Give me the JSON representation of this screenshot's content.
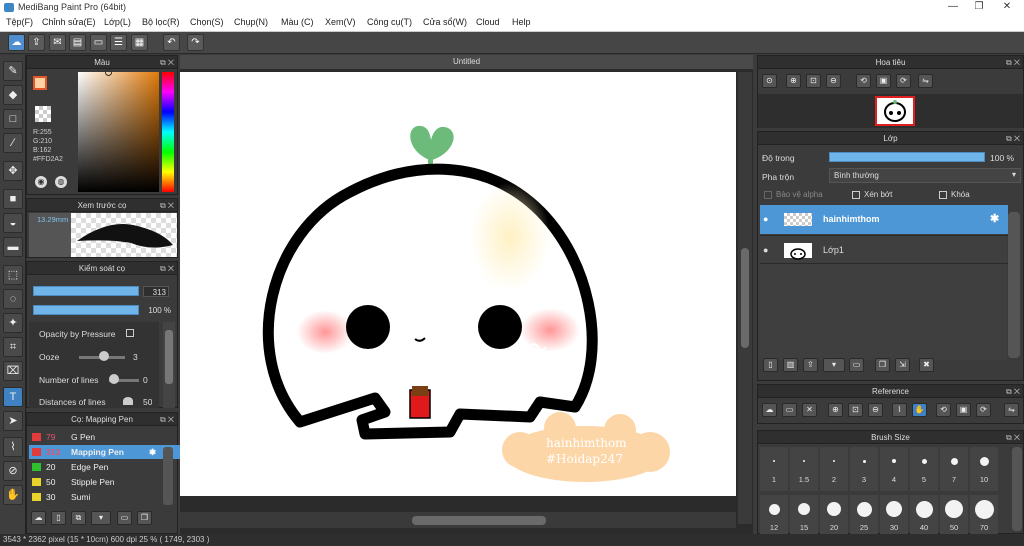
{
  "window": {
    "title": "MediBang Paint Pro (64bit)",
    "minimize": "—",
    "restore": "❐",
    "close": "✕"
  },
  "menu": [
    "Tệp(F)",
    "Chỉnh sửa(E)",
    "Lớp(L)",
    "Bộ lọc(R)",
    "Chọn(S)",
    "Chụp(N)",
    "Màu (C)",
    "Xem(V)",
    "Công cụ(T)",
    "Cửa sổ(W)",
    "Cloud",
    "Help"
  ],
  "canvas": {
    "tab_title": "Untitled",
    "watermark_line1": "hainhimthom",
    "watermark_line2": "#Hoidap247"
  },
  "color_panel": {
    "title": "Màu",
    "r": "R:255",
    "g": "G:210",
    "b": "B:162",
    "hex": "#FFD2A2",
    "accent": "#FFD2A2"
  },
  "brush_preview": {
    "title": "Xem trước cọ",
    "size": "13.29mm"
  },
  "brush_control": {
    "title": "Kiểm soát cọ",
    "size_value": "313",
    "opacity_value": "100 %",
    "opacity_pressure": "Opacity by Pressure",
    "ooze_label": "Ooze",
    "ooze_value": "3",
    "lines_label": "Number of lines",
    "lines_value": "0",
    "distance_label": "Distances of lines",
    "distance_value": "50"
  },
  "brush_list": {
    "title": "Cọ: Mapping Pen",
    "items": [
      {
        "size": "79",
        "name": "G Pen",
        "color": "#e33b3b"
      },
      {
        "size": "313",
        "name": "Mapping Pen",
        "color": "#e33b3b"
      },
      {
        "size": "20",
        "name": "Edge Pen",
        "color": "#2fbf2f"
      },
      {
        "size": "50",
        "name": "Stipple Pen",
        "color": "#e8d22c"
      },
      {
        "size": "30",
        "name": "Sumi",
        "color": "#e8d22c"
      }
    ]
  },
  "navigator": {
    "title": "Hoa tiêu"
  },
  "layers": {
    "title": "Lớp",
    "opacity_label": "Độ trong",
    "opacity_value": "100 %",
    "blend_label": "Pha trộn",
    "blend_value": "Bình thường",
    "protect_alpha": "Bảo vệ alpha",
    "clipping": "Xén bớt",
    "lock": "Khóa",
    "items": [
      {
        "name": "hainhimthom",
        "selected": true
      },
      {
        "name": "Lớp1",
        "selected": false
      }
    ]
  },
  "reference": {
    "title": "Reference"
  },
  "brush_size": {
    "title": "Brush Size",
    "row1": [
      "1",
      "1.5",
      "2",
      "3",
      "4",
      "5",
      "7",
      "10"
    ],
    "row2": [
      "12",
      "15",
      "20",
      "25",
      "30",
      "40",
      "50",
      "70"
    ]
  },
  "status": {
    "text": "3543 * 2362 pixel   (15 * 10cm)   600 dpi   25 %   ( 1749, 2303 )"
  }
}
